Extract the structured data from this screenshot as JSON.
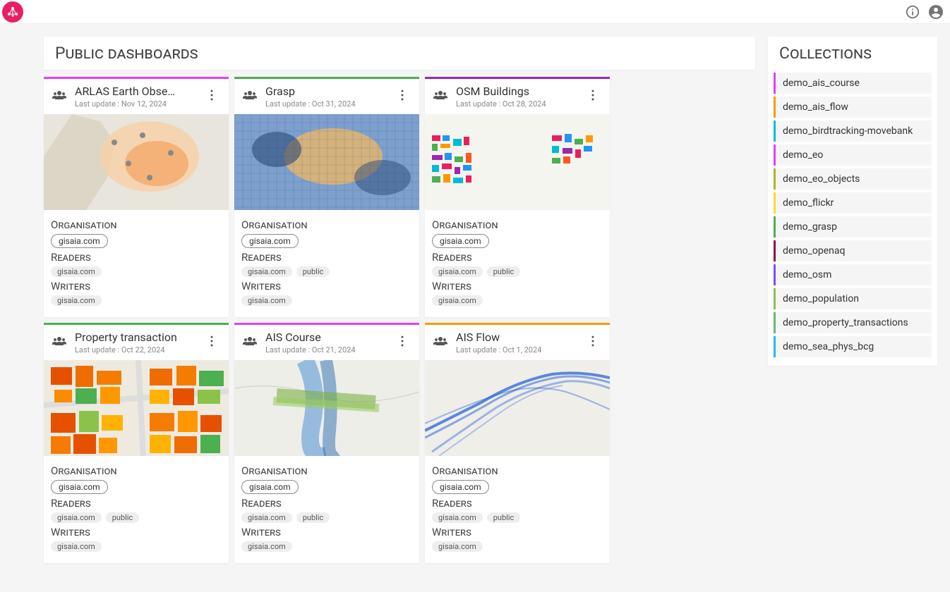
{
  "header": {
    "app": "ARLAS"
  },
  "main": {
    "title": "Public dashboards",
    "org_label": "Organisation",
    "readers_label": "Readers",
    "writers_label": "Writers",
    "update_prefix": "Last update : "
  },
  "cards": [
    {
      "title": "ARLAS Earth Obse…",
      "updated": "Nov 12, 2024",
      "color": "c-magenta",
      "org": [
        "gisaia.com"
      ],
      "readers": [
        "gisaia.com"
      ],
      "writers": [
        "gisaia.com"
      ],
      "thumb": "eo"
    },
    {
      "title": "Grasp",
      "updated": "Oct 31, 2024",
      "color": "c-green",
      "org": [
        "gisaia.com"
      ],
      "readers": [
        "gisaia.com",
        "public"
      ],
      "writers": [
        "gisaia.com"
      ],
      "thumb": "grasp"
    },
    {
      "title": "OSM Buildings",
      "updated": "Oct 28, 2024",
      "color": "c-purple",
      "org": [
        "gisaia.com"
      ],
      "readers": [
        "gisaia.com",
        "public"
      ],
      "writers": [
        "gisaia.com"
      ],
      "thumb": "osm"
    },
    {
      "title": "Property transaction",
      "updated": "Oct 22, 2024",
      "color": "c-green",
      "org": [
        "gisaia.com"
      ],
      "readers": [
        "gisaia.com",
        "public"
      ],
      "writers": [
        "gisaia.com"
      ],
      "thumb": "property"
    },
    {
      "title": "AIS Course",
      "updated": "Oct 21, 2024",
      "color": "c-magenta",
      "org": [
        "gisaia.com"
      ],
      "readers": [
        "gisaia.com",
        "public"
      ],
      "writers": [
        "gisaia.com"
      ],
      "thumb": "ais_course"
    },
    {
      "title": "AIS Flow",
      "updated": "Oct 1, 2024",
      "color": "c-orange",
      "org": [
        "gisaia.com"
      ],
      "readers": [
        "gisaia.com",
        "public"
      ],
      "writers": [
        "gisaia.com"
      ],
      "thumb": "ais_flow"
    }
  ],
  "collections": {
    "title": "Collections",
    "items": [
      {
        "label": "demo_ais_course",
        "color": "c-magenta"
      },
      {
        "label": "demo_ais_flow",
        "color": "c-orange"
      },
      {
        "label": "demo_birdtracking-movebank",
        "color": "c-cyan"
      },
      {
        "label": "demo_eo",
        "color": "c-magenta"
      },
      {
        "label": "demo_eo_objects",
        "color": "c-olive"
      },
      {
        "label": "demo_flickr",
        "color": "c-yellow"
      },
      {
        "label": "demo_grasp",
        "color": "c-green"
      },
      {
        "label": "demo_openaq",
        "color": "c-darkred"
      },
      {
        "label": "demo_osm",
        "color": "c-violet"
      },
      {
        "label": "demo_population",
        "color": "c-lime"
      },
      {
        "label": "demo_property_transactions",
        "color": "c-lgreen"
      },
      {
        "label": "demo_sea_phys_bcg",
        "color": "c-lblue"
      }
    ]
  }
}
